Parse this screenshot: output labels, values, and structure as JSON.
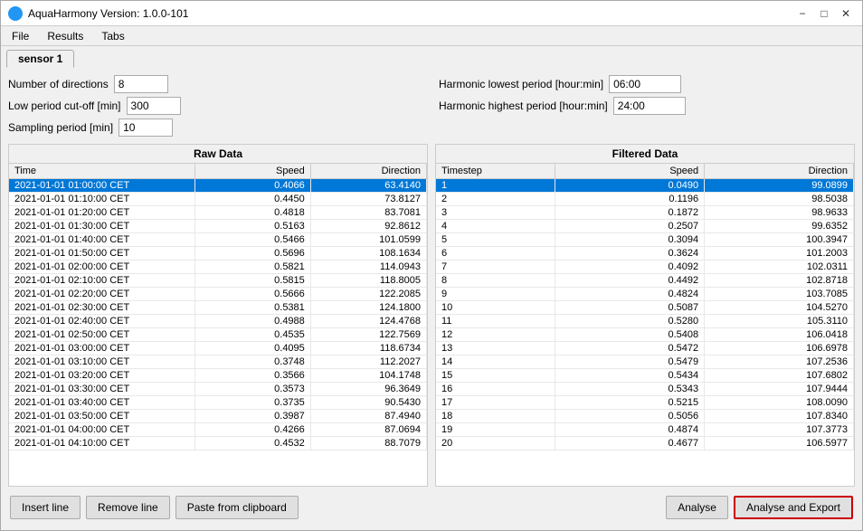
{
  "window": {
    "title": "AquaHarmony Version: 1.0.0-101"
  },
  "menu": {
    "items": [
      "File",
      "Results",
      "Tabs"
    ]
  },
  "tabs": [
    {
      "label": "sensor 1",
      "active": true
    }
  ],
  "params": {
    "num_directions_label": "Number of directions",
    "num_directions_value": "8",
    "harmonic_lowest_label": "Harmonic lowest period [hour:min]",
    "harmonic_lowest_value": "06:00",
    "low_period_label": "Low period cut-off [min]",
    "low_period_value": "300",
    "harmonic_highest_label": "Harmonic highest period [hour:min]",
    "harmonic_highest_value": "24:00",
    "sampling_period_label": "Sampling period [min]",
    "sampling_period_value": "10"
  },
  "raw_data": {
    "title": "Raw Data",
    "columns": [
      "Time",
      "Speed",
      "Direction"
    ],
    "rows": [
      [
        "2021-01-01 01:00:00 CET",
        "0.4066",
        "63.4140"
      ],
      [
        "2021-01-01 01:10:00 CET",
        "0.4450",
        "73.8127"
      ],
      [
        "2021-01-01 01:20:00 CET",
        "0.4818",
        "83.7081"
      ],
      [
        "2021-01-01 01:30:00 CET",
        "0.5163",
        "92.8612"
      ],
      [
        "2021-01-01 01:40:00 CET",
        "0.5466",
        "101.0599"
      ],
      [
        "2021-01-01 01:50:00 CET",
        "0.5696",
        "108.1634"
      ],
      [
        "2021-01-01 02:00:00 CET",
        "0.5821",
        "114.0943"
      ],
      [
        "2021-01-01 02:10:00 CET",
        "0.5815",
        "118.8005"
      ],
      [
        "2021-01-01 02:20:00 CET",
        "0.5666",
        "122.2085"
      ],
      [
        "2021-01-01 02:30:00 CET",
        "0.5381",
        "124.1800"
      ],
      [
        "2021-01-01 02:40:00 CET",
        "0.4988",
        "124.4768"
      ],
      [
        "2021-01-01 02:50:00 CET",
        "0.4535",
        "122.7569"
      ],
      [
        "2021-01-01 03:00:00 CET",
        "0.4095",
        "118.6734"
      ],
      [
        "2021-01-01 03:10:00 CET",
        "0.3748",
        "112.2027"
      ],
      [
        "2021-01-01 03:20:00 CET",
        "0.3566",
        "104.1748"
      ],
      [
        "2021-01-01 03:30:00 CET",
        "0.3573",
        "96.3649"
      ],
      [
        "2021-01-01 03:40:00 CET",
        "0.3735",
        "90.5430"
      ],
      [
        "2021-01-01 03:50:00 CET",
        "0.3987",
        "87.4940"
      ],
      [
        "2021-01-01 04:00:00 CET",
        "0.4266",
        "87.0694"
      ],
      [
        "2021-01-01 04:10:00 CET",
        "0.4532",
        "88.7079"
      ]
    ]
  },
  "filtered_data": {
    "title": "Filtered Data",
    "columns": [
      "Timestep",
      "Speed",
      "Direction"
    ],
    "rows": [
      [
        "1",
        "0.0490",
        "99.0899"
      ],
      [
        "2",
        "0.1196",
        "98.5038"
      ],
      [
        "3",
        "0.1872",
        "98.9633"
      ],
      [
        "4",
        "0.2507",
        "99.6352"
      ],
      [
        "5",
        "0.3094",
        "100.3947"
      ],
      [
        "6",
        "0.3624",
        "101.2003"
      ],
      [
        "7",
        "0.4092",
        "102.0311"
      ],
      [
        "8",
        "0.4492",
        "102.8718"
      ],
      [
        "9",
        "0.4824",
        "103.7085"
      ],
      [
        "10",
        "0.5087",
        "104.5270"
      ],
      [
        "11",
        "0.5280",
        "105.3110"
      ],
      [
        "12",
        "0.5408",
        "106.0418"
      ],
      [
        "13",
        "0.5472",
        "106.6978"
      ],
      [
        "14",
        "0.5479",
        "107.2536"
      ],
      [
        "15",
        "0.5434",
        "107.6802"
      ],
      [
        "16",
        "0.5343",
        "107.9444"
      ],
      [
        "17",
        "0.5215",
        "108.0090"
      ],
      [
        "18",
        "0.5056",
        "107.8340"
      ],
      [
        "19",
        "0.4874",
        "107.3773"
      ],
      [
        "20",
        "0.4677",
        "106.5977"
      ]
    ]
  },
  "footer": {
    "insert_line": "Insert line",
    "remove_line": "Remove line",
    "paste_clipboard": "Paste from clipboard",
    "analyse": "Analyse",
    "analyse_export": "Analyse and Export"
  }
}
